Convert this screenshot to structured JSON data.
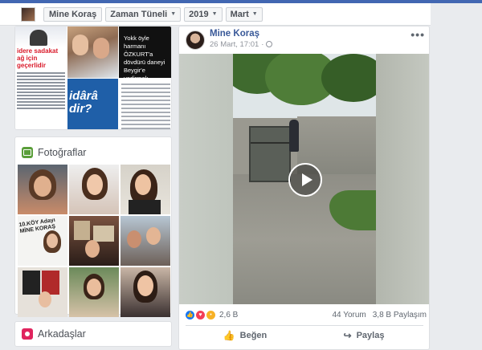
{
  "navbar": {
    "profile_name": "Mine Koraş",
    "timeline_label": "Zaman Tüneli",
    "year": "2019",
    "month": "Mart"
  },
  "intro_tiles": {
    "red_text": "idere sadakat ağ için geçerlidir",
    "black_tile_text": "Yokk öyle harmanı ÖZKURT'a dövdürü daneyi Beygir'e yedirmek,",
    "blue_tile_text": "idârâ dir?"
  },
  "photos": {
    "title": "Fotoğraflar",
    "poster_text": "10.KÖY Adayı MİNE KORAŞ"
  },
  "friends": {
    "title": "Arkadaşlar"
  },
  "post": {
    "author": "Mine Koraş",
    "timestamp": "26 Mart, 17:01",
    "menu": "•••",
    "reactions_count": "2,6 B",
    "comments": "44 Yorum",
    "shares": "3,8 B Paylaşım",
    "like_label": "Beğen",
    "share_label": "Paylaş"
  }
}
